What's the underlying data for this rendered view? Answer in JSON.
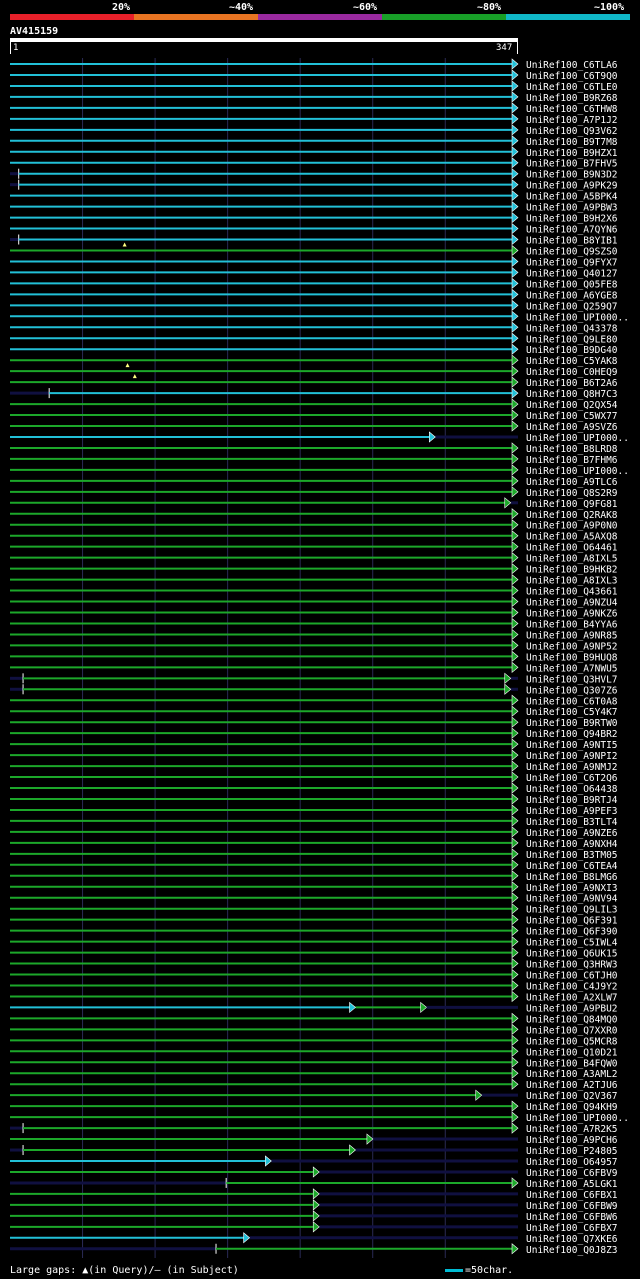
{
  "legend": {
    "segments": [
      {
        "label": "20%",
        "color": "#e8202a"
      },
      {
        "label": "~40%",
        "color": "#e87422"
      },
      {
        "label": "~60%",
        "color": "#9a2aa0"
      },
      {
        "label": "~80%",
        "color": "#18a028"
      },
      {
        "label": "~100%",
        "color": "#10b8c8"
      }
    ]
  },
  "query": {
    "name": "AV415159",
    "start": "1",
    "end": "347"
  },
  "footer": {
    "gaps_text": "Large gaps: ▲(in Query)/– (in Subject)",
    "scale_text": "=50char."
  },
  "chart_data": {
    "type": "alignment-overview",
    "x_range": [
      1,
      347
    ],
    "hits": [
      {
        "name": "UniRef100_C6TLA6",
        "start": 1,
        "end": 347,
        "color": "cyan"
      },
      {
        "name": "UniRef100_C6T9Q0",
        "start": 1,
        "end": 347,
        "color": "cyan"
      },
      {
        "name": "UniRef100_C6TLE0",
        "start": 1,
        "end": 347,
        "color": "cyan"
      },
      {
        "name": "UniRef100_B9RZ68",
        "start": 1,
        "end": 347,
        "color": "cyan"
      },
      {
        "name": "UniRef100_C6THW8",
        "start": 1,
        "end": 347,
        "color": "cyan"
      },
      {
        "name": "UniRef100_A7P1J2",
        "start": 1,
        "end": 347,
        "color": "cyan"
      },
      {
        "name": "UniRef100_Q93V62",
        "start": 1,
        "end": 347,
        "color": "cyan"
      },
      {
        "name": "UniRef100_B9T7M8",
        "start": 1,
        "end": 347,
        "color": "cyan"
      },
      {
        "name": "UniRef100_B9HZX1",
        "start": 1,
        "end": 347,
        "color": "cyan"
      },
      {
        "name": "UniRef100_B7FHV5",
        "start": 1,
        "end": 347,
        "color": "cyan"
      },
      {
        "name": "UniRef100_B9N3D2",
        "start": 7,
        "end": 347,
        "color": "cyan"
      },
      {
        "name": "UniRef100_A9PK29",
        "start": 7,
        "end": 347,
        "color": "cyan"
      },
      {
        "name": "UniRef100_A5BPK4",
        "start": 1,
        "end": 347,
        "color": "cyan"
      },
      {
        "name": "UniRef100_A9PBW3",
        "start": 1,
        "end": 347,
        "color": "cyan"
      },
      {
        "name": "UniRef100_B9H2X6",
        "start": 1,
        "end": 347,
        "color": "cyan"
      },
      {
        "name": "UniRef100_A7QYN6",
        "start": 1,
        "end": 347,
        "color": "cyan"
      },
      {
        "name": "UniRef100_B8YIB1",
        "start": 7,
        "end": 347,
        "color": "cyan"
      },
      {
        "name": "UniRef100_Q9SZS0",
        "start": 1,
        "end": 347,
        "color": "green",
        "qgap": 80
      },
      {
        "name": "UniRef100_Q9FYX7",
        "start": 1,
        "end": 347,
        "color": "cyan"
      },
      {
        "name": "UniRef100_Q40127",
        "start": 1,
        "end": 347,
        "color": "cyan"
      },
      {
        "name": "UniRef100_Q05FE8",
        "start": 1,
        "end": 347,
        "color": "cyan"
      },
      {
        "name": "UniRef100_A6YGE8",
        "start": 1,
        "end": 347,
        "color": "cyan"
      },
      {
        "name": "UniRef100_Q259Q7",
        "start": 1,
        "end": 347,
        "color": "cyan"
      },
      {
        "name": "UniRef100_UPI000..",
        "start": 1,
        "end": 347,
        "color": "cyan"
      },
      {
        "name": "UniRef100_Q43378",
        "start": 1,
        "end": 347,
        "color": "cyan"
      },
      {
        "name": "UniRef100_Q9LE80",
        "start": 1,
        "end": 347,
        "color": "cyan"
      },
      {
        "name": "UniRef100_B9DG40",
        "start": 1,
        "end": 347,
        "color": "cyan"
      },
      {
        "name": "UniRef100_C5YAK8",
        "start": 1,
        "end": 347,
        "color": "green"
      },
      {
        "name": "UniRef100_C0HEQ9",
        "start": 1,
        "end": 347,
        "color": "green",
        "qgap": 82
      },
      {
        "name": "UniRef100_B6T2A6",
        "start": 1,
        "end": 347,
        "color": "green",
        "qgap": 87
      },
      {
        "name": "UniRef100_Q8H7C3",
        "start": 28,
        "end": 347,
        "color": "cyan"
      },
      {
        "name": "UniRef100_Q2QX54",
        "start": 1,
        "end": 347,
        "color": "green"
      },
      {
        "name": "UniRef100_C5WX77",
        "start": 1,
        "end": 347,
        "color": "green"
      },
      {
        "name": "UniRef100_A9SVZ6",
        "start": 1,
        "end": 347,
        "color": "green"
      },
      {
        "name": "UniRef100_UPI000..",
        "start": 1,
        "end": 290,
        "color": "cyan"
      },
      {
        "name": "UniRef100_B8LRD8",
        "start": 1,
        "end": 347,
        "color": "green"
      },
      {
        "name": "UniRef100_B7FHM6",
        "start": 1,
        "end": 347,
        "color": "green"
      },
      {
        "name": "UniRef100_UPI000..",
        "start": 1,
        "end": 347,
        "color": "green"
      },
      {
        "name": "UniRef100_A9TLC6",
        "start": 1,
        "end": 347,
        "color": "green"
      },
      {
        "name": "UniRef100_Q8S2R9",
        "start": 1,
        "end": 347,
        "color": "green"
      },
      {
        "name": "UniRef100_Q9FG81",
        "start": 1,
        "end": 342,
        "color": "green"
      },
      {
        "name": "UniRef100_Q2RAK8",
        "start": 1,
        "end": 347,
        "color": "green"
      },
      {
        "name": "UniRef100_A9P0N0",
        "start": 1,
        "end": 347,
        "color": "green"
      },
      {
        "name": "UniRef100_A5AXQ8",
        "start": 1,
        "end": 347,
        "color": "green"
      },
      {
        "name": "UniRef100_O64461",
        "start": 1,
        "end": 347,
        "color": "green"
      },
      {
        "name": "UniRef100_A8IXL5",
        "start": 1,
        "end": 347,
        "color": "green"
      },
      {
        "name": "UniRef100_B9HKB2",
        "start": 1,
        "end": 347,
        "color": "green"
      },
      {
        "name": "UniRef100_A8IXL3",
        "start": 1,
        "end": 347,
        "color": "green"
      },
      {
        "name": "UniRef100_Q43661",
        "start": 1,
        "end": 347,
        "color": "green"
      },
      {
        "name": "UniRef100_A9NZU4",
        "start": 1,
        "end": 347,
        "color": "green"
      },
      {
        "name": "UniRef100_A9NKZ6",
        "start": 1,
        "end": 347,
        "color": "green"
      },
      {
        "name": "UniRef100_B4YYA6",
        "start": 1,
        "end": 347,
        "color": "green"
      },
      {
        "name": "UniRef100_A9NR85",
        "start": 1,
        "end": 347,
        "color": "green"
      },
      {
        "name": "UniRef100_A9NP52",
        "start": 1,
        "end": 347,
        "color": "green"
      },
      {
        "name": "UniRef100_B9HUQ8",
        "start": 1,
        "end": 347,
        "color": "green"
      },
      {
        "name": "UniRef100_A7NWU5",
        "start": 1,
        "end": 347,
        "color": "green"
      },
      {
        "name": "UniRef100_Q3HVL7",
        "start": 10,
        "end": 342,
        "color": "green"
      },
      {
        "name": "UniRef100_Q307Z6",
        "start": 10,
        "end": 342,
        "color": "green"
      },
      {
        "name": "UniRef100_C6T0A8",
        "start": 1,
        "end": 347,
        "color": "green"
      },
      {
        "name": "UniRef100_C5Y4K7",
        "start": 1,
        "end": 347,
        "color": "green"
      },
      {
        "name": "UniRef100_B9RTW0",
        "start": 1,
        "end": 347,
        "color": "green"
      },
      {
        "name": "UniRef100_Q94BR2",
        "start": 1,
        "end": 347,
        "color": "green"
      },
      {
        "name": "UniRef100_A9NTI5",
        "start": 1,
        "end": 347,
        "color": "green"
      },
      {
        "name": "UniRef100_A9NPI2",
        "start": 1,
        "end": 347,
        "color": "green"
      },
      {
        "name": "UniRef100_A9NMJ2",
        "start": 1,
        "end": 347,
        "color": "green"
      },
      {
        "name": "UniRef100_C6T2Q6",
        "start": 1,
        "end": 347,
        "color": "green"
      },
      {
        "name": "UniRef100_O64438",
        "start": 1,
        "end": 347,
        "color": "green"
      },
      {
        "name": "UniRef100_B9RTJ4",
        "start": 1,
        "end": 347,
        "color": "green"
      },
      {
        "name": "UniRef100_A9PEF3",
        "start": 1,
        "end": 347,
        "color": "green"
      },
      {
        "name": "UniRef100_B3TLT4",
        "start": 1,
        "end": 347,
        "color": "green"
      },
      {
        "name": "UniRef100_A9NZE6",
        "start": 1,
        "end": 347,
        "color": "green"
      },
      {
        "name": "UniRef100_A9NXH4",
        "start": 1,
        "end": 347,
        "color": "green"
      },
      {
        "name": "UniRef100_B3TM05",
        "start": 1,
        "end": 347,
        "color": "green"
      },
      {
        "name": "UniRef100_C6TEA4",
        "start": 1,
        "end": 347,
        "color": "green"
      },
      {
        "name": "UniRef100_B8LMG6",
        "start": 1,
        "end": 347,
        "color": "green"
      },
      {
        "name": "UniRef100_A9NXI3",
        "start": 1,
        "end": 347,
        "color": "green"
      },
      {
        "name": "UniRef100_A9NV94",
        "start": 1,
        "end": 347,
        "color": "green"
      },
      {
        "name": "UniRef100_Q9LIL3",
        "start": 1,
        "end": 347,
        "color": "green"
      },
      {
        "name": "UniRef100_Q6F391",
        "start": 1,
        "end": 347,
        "color": "green"
      },
      {
        "name": "UniRef100_Q6F390",
        "start": 1,
        "end": 347,
        "color": "green"
      },
      {
        "name": "UniRef100_C5IWL4",
        "start": 1,
        "end": 347,
        "color": "green"
      },
      {
        "name": "UniRef100_Q6UK15",
        "start": 1,
        "end": 347,
        "color": "green"
      },
      {
        "name": "UniRef100_Q3HRW3",
        "start": 1,
        "end": 347,
        "color": "green"
      },
      {
        "name": "UniRef100_C6TJH0",
        "start": 1,
        "end": 347,
        "color": "green"
      },
      {
        "name": "UniRef100_C4J9Y2",
        "start": 1,
        "end": 347,
        "color": "green"
      },
      {
        "name": "UniRef100_A2XLW7",
        "start": 1,
        "end": 347,
        "color": "green"
      },
      {
        "name": "UniRef100_A9PBU2",
        "start": 1,
        "end": 235,
        "color": "cyan",
        "extra": {
          "start": 235,
          "end": 284,
          "color": "green"
        }
      },
      {
        "name": "UniRef100_Q84MQ0",
        "start": 1,
        "end": 347,
        "color": "green"
      },
      {
        "name": "UniRef100_Q7XXR0",
        "start": 1,
        "end": 347,
        "color": "green"
      },
      {
        "name": "UniRef100_Q5MCR8",
        "start": 1,
        "end": 347,
        "color": "green"
      },
      {
        "name": "UniRef100_Q10D21",
        "start": 1,
        "end": 347,
        "color": "green"
      },
      {
        "name": "UniRef100_B4FQW0",
        "start": 1,
        "end": 347,
        "color": "green"
      },
      {
        "name": "UniRef100_A3AML2",
        "start": 1,
        "end": 347,
        "color": "green"
      },
      {
        "name": "UniRef100_A2TJU6",
        "start": 1,
        "end": 347,
        "color": "green"
      },
      {
        "name": "UniRef100_Q2V367",
        "start": 1,
        "end": 322,
        "color": "green"
      },
      {
        "name": "UniRef100_Q94KH9",
        "start": 1,
        "end": 347,
        "color": "green"
      },
      {
        "name": "UniRef100_UPI000..",
        "start": 1,
        "end": 347,
        "color": "green"
      },
      {
        "name": "UniRef100_A7R2K5",
        "start": 10,
        "end": 347,
        "color": "green"
      },
      {
        "name": "UniRef100_A9PCH6",
        "start": 1,
        "end": 247,
        "color": "green"
      },
      {
        "name": "UniRef100_P24805",
        "start": 10,
        "end": 235,
        "color": "green"
      },
      {
        "name": "UniRef100_O64957",
        "start": 1,
        "end": 177,
        "color": "cyan"
      },
      {
        "name": "UniRef100_C6FBV9",
        "start": 1,
        "end": 210,
        "color": "green"
      },
      {
        "name": "UniRef100_A5LGK1",
        "start": 150,
        "end": 347,
        "color": "green"
      },
      {
        "name": "UniRef100_C6FBX1",
        "start": 1,
        "end": 210,
        "color": "green"
      },
      {
        "name": "UniRef100_C6FBW9",
        "start": 1,
        "end": 210,
        "color": "green"
      },
      {
        "name": "UniRef100_C6FBW6",
        "start": 1,
        "end": 210,
        "color": "green"
      },
      {
        "name": "UniRef100_C6FBX7",
        "start": 1,
        "end": 210,
        "color": "green"
      },
      {
        "name": "UniRef100_Q7XKE6",
        "start": 1,
        "end": 162,
        "color": "cyan"
      },
      {
        "name": "UniRef100_Q0J8Z3",
        "start": 143,
        "end": 347,
        "color": "green"
      }
    ]
  }
}
